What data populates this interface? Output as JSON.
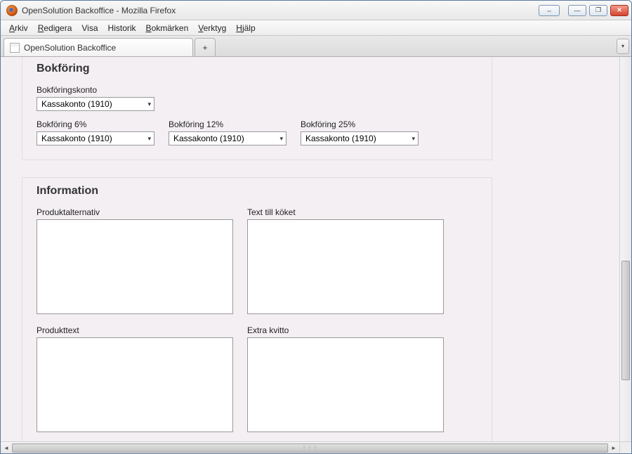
{
  "window": {
    "title": "OpenSolution Backoffice - Mozilla Firefox"
  },
  "menubar": {
    "arkiv": "Arkiv",
    "redigera": "Redigera",
    "visa": "Visa",
    "historik": "Historik",
    "bokmarken": "Bokmärken",
    "verktyg": "Verktyg",
    "hjalp": "Hjälp"
  },
  "tabs": {
    "active_label": "OpenSolution Backoffice",
    "new_tab_symbol": "+"
  },
  "bokforing": {
    "heading": "Bokföring",
    "konto_label": "Bokföringskonto",
    "konto_value": "Kassakonto (1910)",
    "label_6": "Bokföring 6%",
    "value_6": "Kassakonto (1910)",
    "label_12": "Bokföring 12%",
    "value_12": "Kassakonto (1910)",
    "label_25": "Bokföring 25%",
    "value_25": "Kassakonto (1910)"
  },
  "information": {
    "heading": "Information",
    "produktalternativ_label": "Produktalternativ",
    "produktalternativ_value": "",
    "text_till_koket_label": "Text till köket",
    "text_till_koket_value": "",
    "produkttext_label": "Produkttext",
    "produkttext_value": "",
    "extra_kvitto_label": "Extra kvitto",
    "extra_kvitto_value": ""
  },
  "icons": {
    "chevron_down": "▾",
    "chevron_left": "◄",
    "chevron_right": "►",
    "arrows_lr": "⇔",
    "minimize": "—",
    "maximize": "❐",
    "close": "✕",
    "grip": "⋮⋮⋮"
  }
}
